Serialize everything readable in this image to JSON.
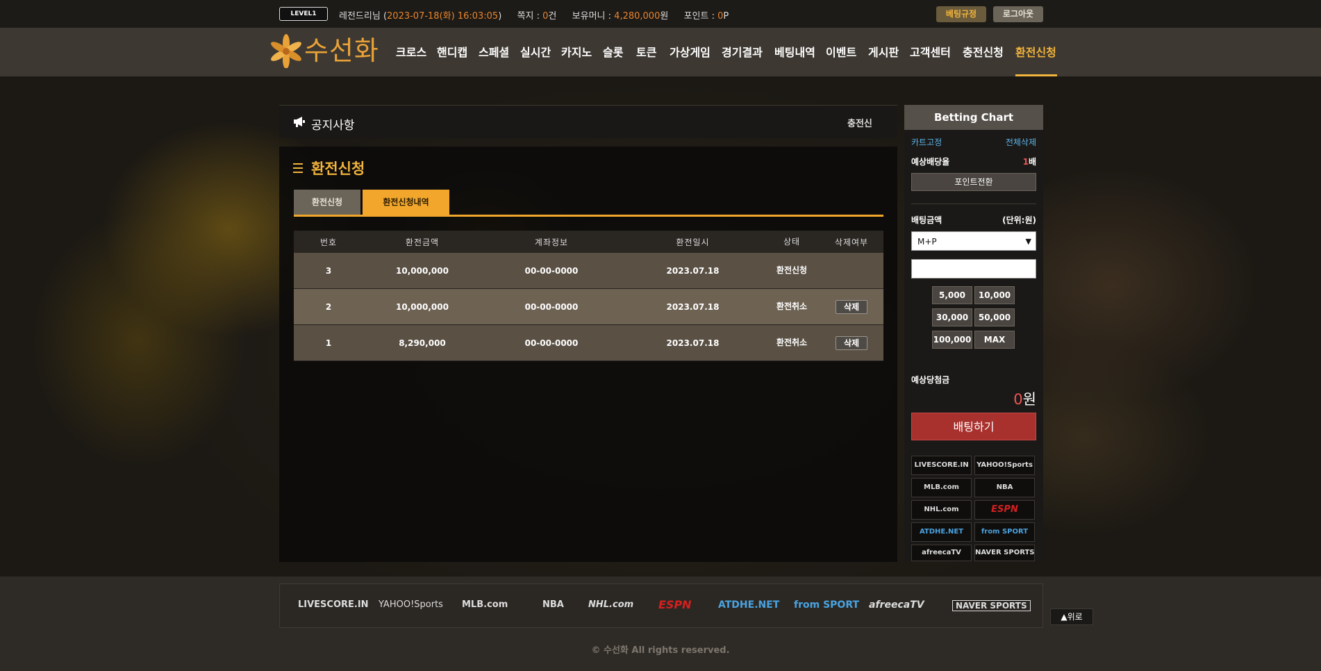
{
  "topbar": {
    "level_badge": "LEVEL1",
    "user_name": "레전드리님",
    "datetime": "2023-07-18(화) 16:03:05",
    "messages_label": "쪽지 :",
    "messages_value": "0",
    "messages_unit": "건",
    "money_label": "보유머니 :",
    "money_value": "4,280,000",
    "money_unit": "원",
    "point_label": "포인트 :",
    "point_value": "0",
    "point_unit": "P",
    "rules_button": "베팅규정",
    "logout_button": "로그아웃"
  },
  "brand": {
    "logo_text": "수선화"
  },
  "nav": {
    "items": [
      "크로스",
      "핸디캡",
      "스페셜",
      "실시간",
      "카지노",
      "슬롯",
      "토큰",
      "가상게임",
      "경기결과",
      "베팅내역",
      "이벤트",
      "게시판",
      "고객센터",
      "충전신청",
      "환전신청"
    ],
    "active": "환전신청"
  },
  "notice": {
    "title": "공지사항",
    "right_text": "충전신"
  },
  "page": {
    "title": "환전신청",
    "tabs": [
      "환전신청",
      "환전신청내역"
    ],
    "active_tab": "환전신청내역"
  },
  "table": {
    "columns": [
      "번호",
      "환전금액",
      "계좌정보",
      "환전일시",
      "상태",
      "삭제여부"
    ],
    "rows": [
      {
        "no": "3",
        "amount": "10,000,000",
        "account": "00-00-0000",
        "date": "2023.07.18",
        "status": "환전신청",
        "delete": ""
      },
      {
        "no": "2",
        "amount": "10,000,000",
        "account": "00-00-0000",
        "date": "2023.07.18",
        "status": "환전취소",
        "delete": "삭제"
      },
      {
        "no": "1",
        "amount": "8,290,000",
        "account": "00-00-0000",
        "date": "2023.07.18",
        "status": "환전취소",
        "delete": "삭제"
      }
    ]
  },
  "betting_chart": {
    "title": "Betting Chart",
    "fix_cart": "카트고정",
    "delete_all": "전체삭제",
    "expected_odds_label": "예상배당율",
    "expected_odds_value": "1",
    "expected_odds_unit": "배",
    "point_convert_button": "포인트전환",
    "bet_amount_label": "배팅금액",
    "bet_amount_unit": "(단위:원)",
    "select_value": "M+P",
    "amount_input_value": "",
    "amount_buttons": [
      "5,000",
      "10,000",
      "30,000",
      "50,000",
      "100,000",
      "MAX"
    ],
    "expected_win_label": "예상당첨금",
    "expected_win_value": "0",
    "expected_win_unit": "원",
    "bet_button": "배팅하기",
    "sport_links": [
      "LIVESCORE.IN",
      "YAHOO!Sports",
      "MLB.com",
      "NBA",
      "NHL.com",
      "ESPN",
      "ATDHE.NET",
      "from SPORT",
      "afreecaTV",
      "NAVER SPORTS"
    ]
  },
  "footer": {
    "logos": [
      "LIVESCORE.IN",
      "YAHOO!Sports",
      "MLB.com",
      "NBA",
      "NHL.com",
      "ESPN",
      "ATDHE.NET",
      "from SPORT",
      "afreecaTV",
      "NAVER SPORTS"
    ],
    "top_button": "▲위로",
    "copyright": "© 수선화 All rights reserved."
  },
  "colors": {
    "accent": "#f2b43c",
    "orange_text": "#e8842c",
    "bet_button": "#a8312e",
    "link": "#5cb4e8"
  }
}
